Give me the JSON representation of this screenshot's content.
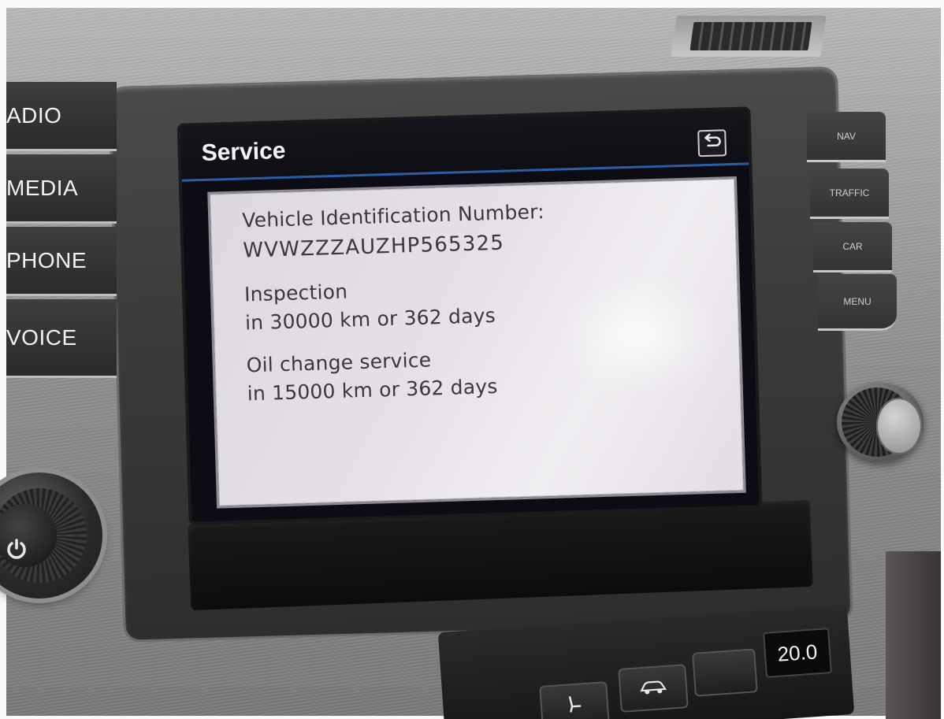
{
  "screen": {
    "title": "Service",
    "vin_label": "Vehicle Identification Number:",
    "vin_value": "WVWZZZAUZHP565325",
    "inspection_label": "Inspection",
    "inspection_due": "in 30000 km or 362 days",
    "oil_label": "Oil change service",
    "oil_due": "in 15000 km or 362 days",
    "back_icon": "back-arrow-icon"
  },
  "left_keys": [
    {
      "label": "ADIO"
    },
    {
      "label": "MEDIA"
    },
    {
      "label": "PHONE"
    },
    {
      "label": "VOICE"
    }
  ],
  "right_keys": [
    {
      "label": "NAV"
    },
    {
      "label": "TRAFFIC"
    },
    {
      "label": "CAR"
    },
    {
      "label": "MENU"
    }
  ],
  "climate": {
    "temperature": "20.0"
  },
  "colors": {
    "title_bar": "#14161c",
    "accent_line": "#2a5fa8",
    "panel": "#e6e1e8",
    "panel_text": "#3a3740"
  }
}
